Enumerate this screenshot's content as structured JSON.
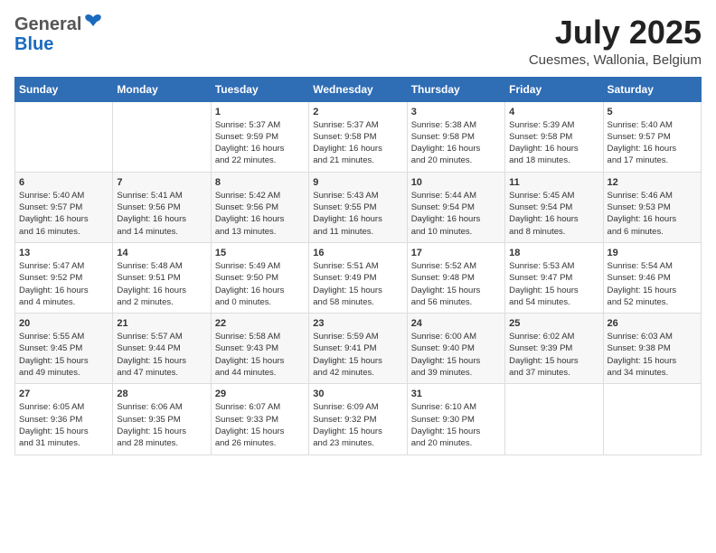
{
  "header": {
    "logo": {
      "line1": "General",
      "line2": "Blue"
    },
    "month": "July 2025",
    "location": "Cuesmes, Wallonia, Belgium"
  },
  "columns": [
    "Sunday",
    "Monday",
    "Tuesday",
    "Wednesday",
    "Thursday",
    "Friday",
    "Saturday"
  ],
  "weeks": [
    [
      {
        "day": "",
        "info": ""
      },
      {
        "day": "",
        "info": ""
      },
      {
        "day": "1",
        "info": "Sunrise: 5:37 AM\nSunset: 9:59 PM\nDaylight: 16 hours\nand 22 minutes."
      },
      {
        "day": "2",
        "info": "Sunrise: 5:37 AM\nSunset: 9:58 PM\nDaylight: 16 hours\nand 21 minutes."
      },
      {
        "day": "3",
        "info": "Sunrise: 5:38 AM\nSunset: 9:58 PM\nDaylight: 16 hours\nand 20 minutes."
      },
      {
        "day": "4",
        "info": "Sunrise: 5:39 AM\nSunset: 9:58 PM\nDaylight: 16 hours\nand 18 minutes."
      },
      {
        "day": "5",
        "info": "Sunrise: 5:40 AM\nSunset: 9:57 PM\nDaylight: 16 hours\nand 17 minutes."
      }
    ],
    [
      {
        "day": "6",
        "info": "Sunrise: 5:40 AM\nSunset: 9:57 PM\nDaylight: 16 hours\nand 16 minutes."
      },
      {
        "day": "7",
        "info": "Sunrise: 5:41 AM\nSunset: 9:56 PM\nDaylight: 16 hours\nand 14 minutes."
      },
      {
        "day": "8",
        "info": "Sunrise: 5:42 AM\nSunset: 9:56 PM\nDaylight: 16 hours\nand 13 minutes."
      },
      {
        "day": "9",
        "info": "Sunrise: 5:43 AM\nSunset: 9:55 PM\nDaylight: 16 hours\nand 11 minutes."
      },
      {
        "day": "10",
        "info": "Sunrise: 5:44 AM\nSunset: 9:54 PM\nDaylight: 16 hours\nand 10 minutes."
      },
      {
        "day": "11",
        "info": "Sunrise: 5:45 AM\nSunset: 9:54 PM\nDaylight: 16 hours\nand 8 minutes."
      },
      {
        "day": "12",
        "info": "Sunrise: 5:46 AM\nSunset: 9:53 PM\nDaylight: 16 hours\nand 6 minutes."
      }
    ],
    [
      {
        "day": "13",
        "info": "Sunrise: 5:47 AM\nSunset: 9:52 PM\nDaylight: 16 hours\nand 4 minutes."
      },
      {
        "day": "14",
        "info": "Sunrise: 5:48 AM\nSunset: 9:51 PM\nDaylight: 16 hours\nand 2 minutes."
      },
      {
        "day": "15",
        "info": "Sunrise: 5:49 AM\nSunset: 9:50 PM\nDaylight: 16 hours\nand 0 minutes."
      },
      {
        "day": "16",
        "info": "Sunrise: 5:51 AM\nSunset: 9:49 PM\nDaylight: 15 hours\nand 58 minutes."
      },
      {
        "day": "17",
        "info": "Sunrise: 5:52 AM\nSunset: 9:48 PM\nDaylight: 15 hours\nand 56 minutes."
      },
      {
        "day": "18",
        "info": "Sunrise: 5:53 AM\nSunset: 9:47 PM\nDaylight: 15 hours\nand 54 minutes."
      },
      {
        "day": "19",
        "info": "Sunrise: 5:54 AM\nSunset: 9:46 PM\nDaylight: 15 hours\nand 52 minutes."
      }
    ],
    [
      {
        "day": "20",
        "info": "Sunrise: 5:55 AM\nSunset: 9:45 PM\nDaylight: 15 hours\nand 49 minutes."
      },
      {
        "day": "21",
        "info": "Sunrise: 5:57 AM\nSunset: 9:44 PM\nDaylight: 15 hours\nand 47 minutes."
      },
      {
        "day": "22",
        "info": "Sunrise: 5:58 AM\nSunset: 9:43 PM\nDaylight: 15 hours\nand 44 minutes."
      },
      {
        "day": "23",
        "info": "Sunrise: 5:59 AM\nSunset: 9:41 PM\nDaylight: 15 hours\nand 42 minutes."
      },
      {
        "day": "24",
        "info": "Sunrise: 6:00 AM\nSunset: 9:40 PM\nDaylight: 15 hours\nand 39 minutes."
      },
      {
        "day": "25",
        "info": "Sunrise: 6:02 AM\nSunset: 9:39 PM\nDaylight: 15 hours\nand 37 minutes."
      },
      {
        "day": "26",
        "info": "Sunrise: 6:03 AM\nSunset: 9:38 PM\nDaylight: 15 hours\nand 34 minutes."
      }
    ],
    [
      {
        "day": "27",
        "info": "Sunrise: 6:05 AM\nSunset: 9:36 PM\nDaylight: 15 hours\nand 31 minutes."
      },
      {
        "day": "28",
        "info": "Sunrise: 6:06 AM\nSunset: 9:35 PM\nDaylight: 15 hours\nand 28 minutes."
      },
      {
        "day": "29",
        "info": "Sunrise: 6:07 AM\nSunset: 9:33 PM\nDaylight: 15 hours\nand 26 minutes."
      },
      {
        "day": "30",
        "info": "Sunrise: 6:09 AM\nSunset: 9:32 PM\nDaylight: 15 hours\nand 23 minutes."
      },
      {
        "day": "31",
        "info": "Sunrise: 6:10 AM\nSunset: 9:30 PM\nDaylight: 15 hours\nand 20 minutes."
      },
      {
        "day": "",
        "info": ""
      },
      {
        "day": "",
        "info": ""
      }
    ]
  ]
}
